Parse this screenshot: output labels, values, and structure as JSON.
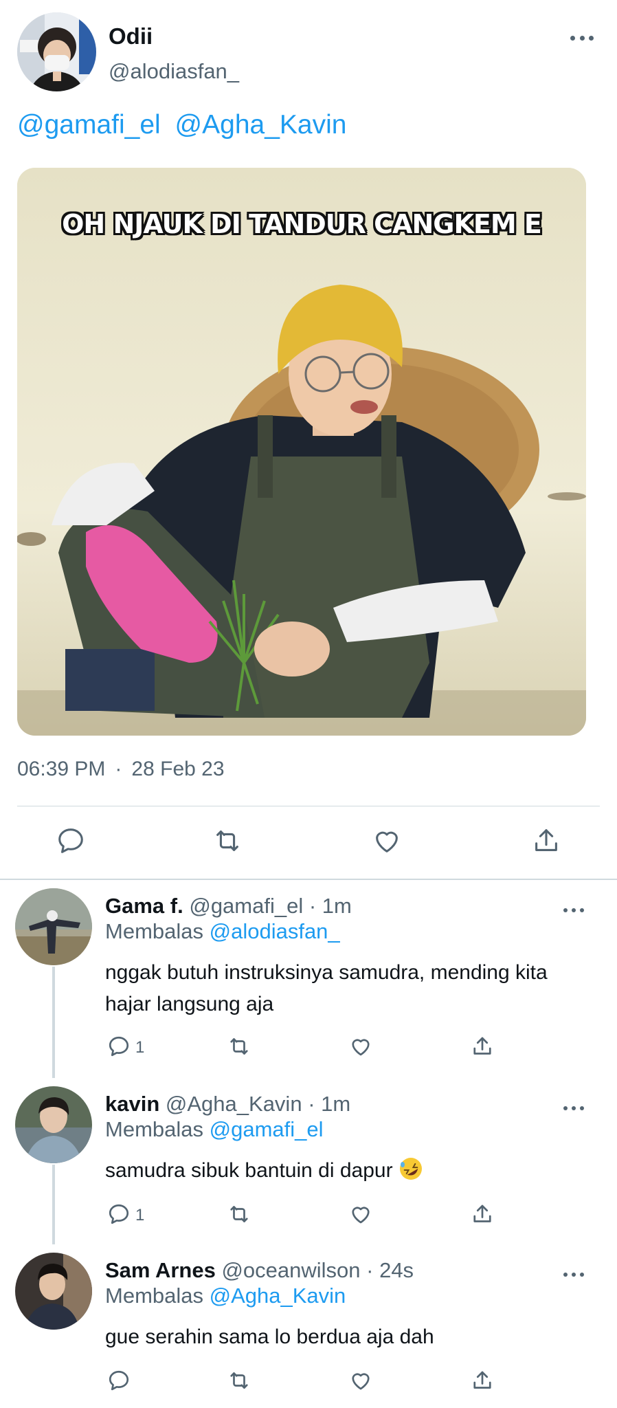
{
  "tweet": {
    "display_name": "Odii",
    "handle": "@alodiasfan_",
    "mentions": [
      "@gamafi_el",
      "@Agha_Kavin"
    ],
    "media_caption": "OH NJAUK DI TANDUR CANGKEM E",
    "time": "06:39 PM",
    "separator": "·",
    "date": "28 Feb 23"
  },
  "replies": [
    {
      "name": "Gama f.",
      "handle": "@gamafi_el",
      "time": "· 1m",
      "replying_prefix": "Membalas",
      "replying_to": "@alodiasfan_",
      "text": "nggak butuh instruksinya samudra, mending kita hajar langsung aja",
      "reply_count": "1"
    },
    {
      "name": "kavin",
      "handle": "@Agha_Kavin",
      "time": "· 1m",
      "replying_prefix": "Membalas",
      "replying_to": "@gamafi_el",
      "text": "samudra sibuk bantuin di dapur",
      "reply_count": "1"
    },
    {
      "name": "Sam Arnes",
      "handle": "@oceanwilson",
      "time": "· 24s",
      "replying_prefix": "Membalas",
      "replying_to": "@Agha_Kavin",
      "text": "gue serahin sama lo berdua aja dah",
      "reply_count": ""
    }
  ],
  "icons": {
    "reply": "speech-bubble-icon",
    "retweet": "retweet-icon",
    "like": "heart-icon",
    "share": "share-upload-icon",
    "more": "more-dots-icon",
    "emoji": "rolling-on-floor-laughing-emoji"
  },
  "colors": {
    "link": "#1d9bf0",
    "secondary_text": "#536471",
    "primary_text": "#0f1419",
    "divider": "#cfd9de"
  }
}
